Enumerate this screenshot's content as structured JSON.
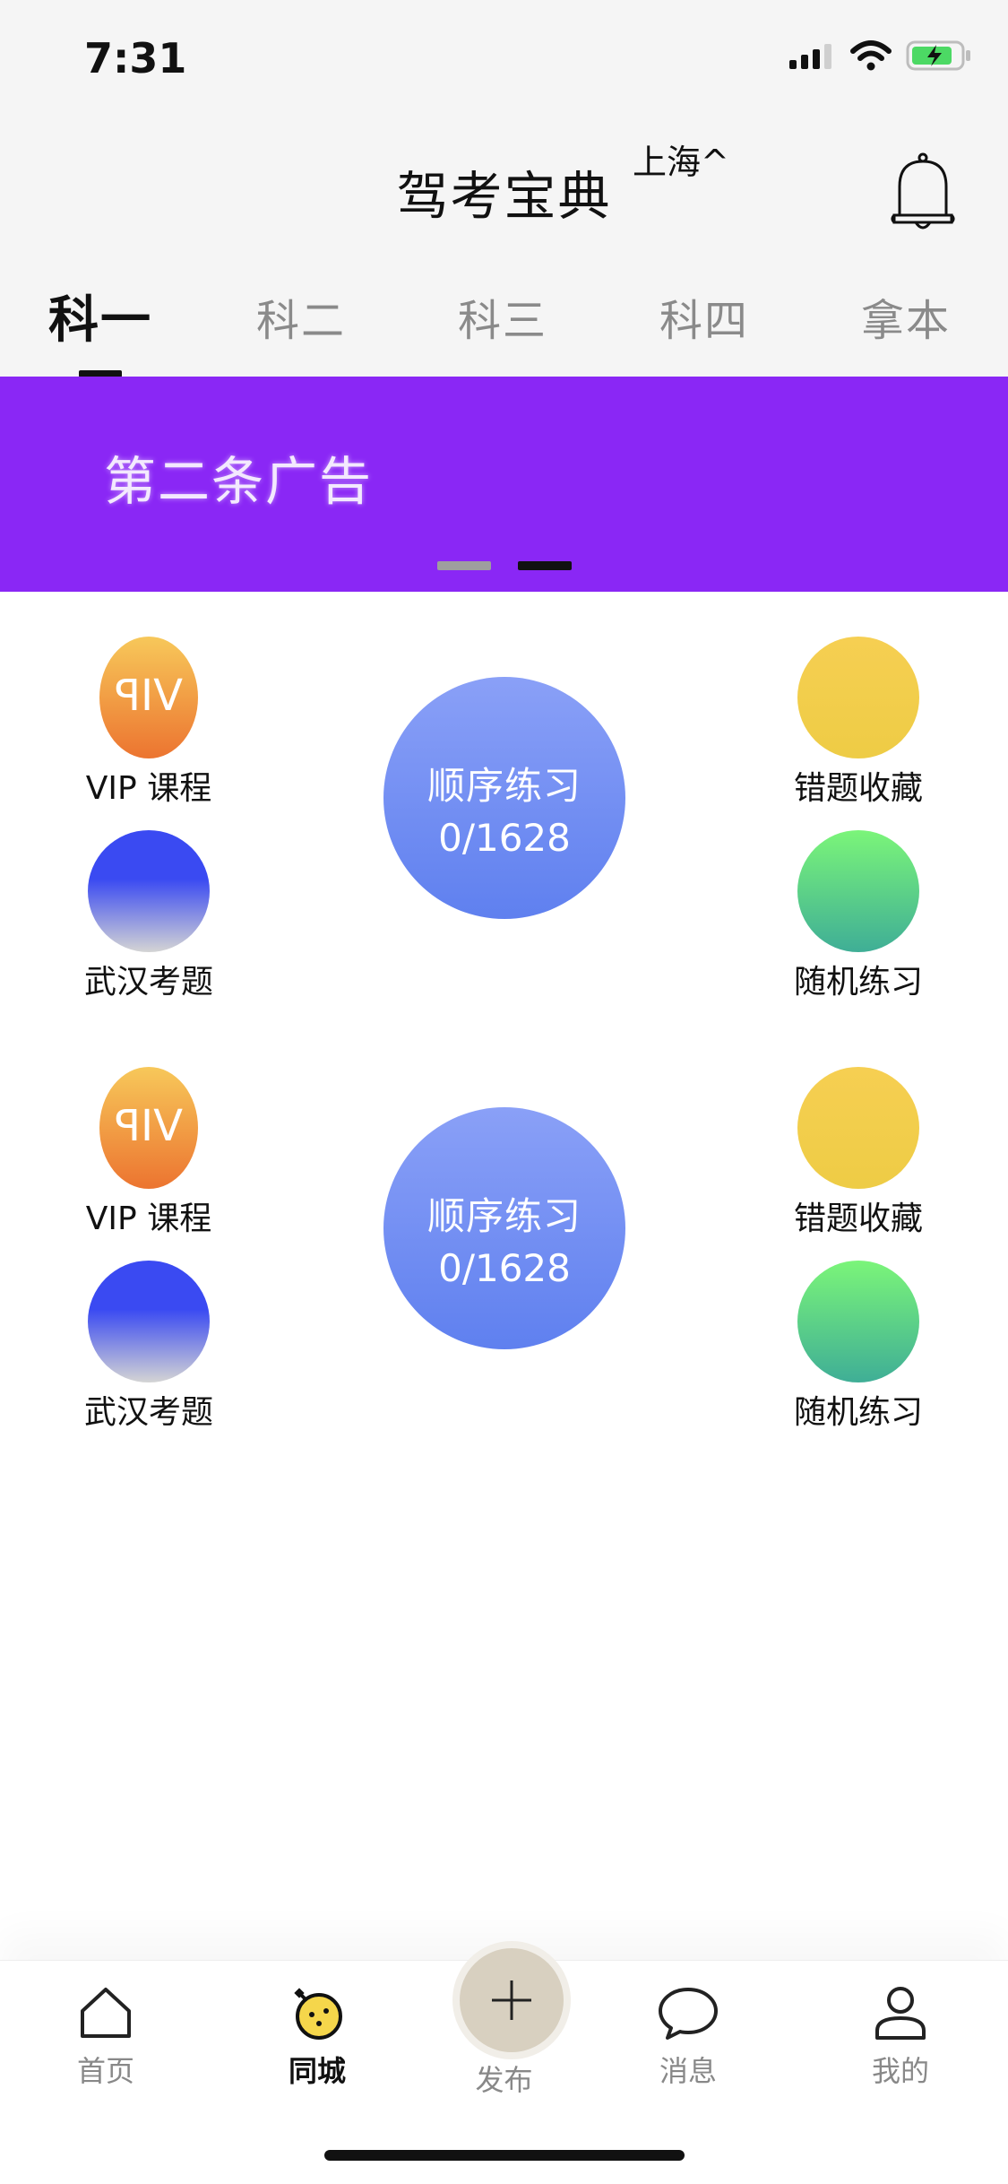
{
  "status": {
    "time": "7:31"
  },
  "header": {
    "title": "驾考宝典",
    "city": "上海^"
  },
  "tabs": [
    "科一",
    "科二",
    "科三",
    "科四",
    "拿本"
  ],
  "banner": {
    "text": "第二条广告"
  },
  "blocks": [
    {
      "left_top": {
        "icon_text": "VIP",
        "label": "VIP 课程"
      },
      "left_bottom": {
        "label": "武汉考题"
      },
      "center": {
        "line1": "顺序练习",
        "line2": "0/1628"
      },
      "right_top": {
        "label": "错题收藏"
      },
      "right_bottom": {
        "label": "随机练习"
      }
    },
    {
      "left_top": {
        "icon_text": "VIP",
        "label": "VIP 课程"
      },
      "left_bottom": {
        "label": "武汉考题"
      },
      "center": {
        "line1": "顺序练习",
        "line2": "0/1628"
      },
      "right_top": {
        "label": "错题收藏"
      },
      "right_bottom": {
        "label": "随机练习"
      }
    }
  ],
  "nav": {
    "home": "首页",
    "city": "同城",
    "publish": "发布",
    "messages": "消息",
    "mine": "我的"
  },
  "colors": {
    "banner": "#8a27f5",
    "center_circle": "#6f8ff2"
  }
}
